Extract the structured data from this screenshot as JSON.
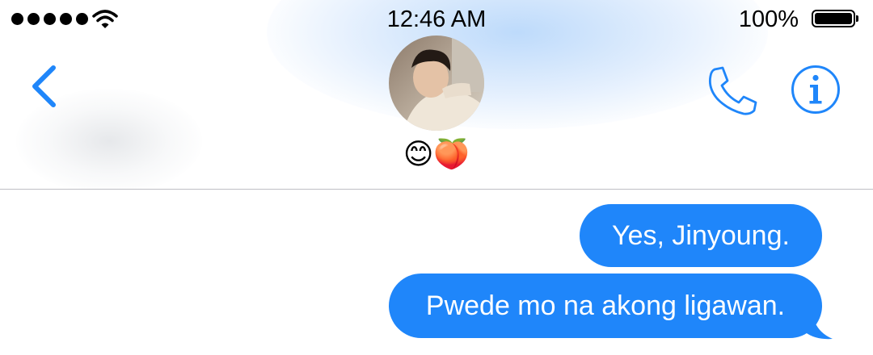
{
  "status_bar": {
    "time": "12:46 AM",
    "battery_percent": "100%",
    "signal_bars": 5,
    "wifi_icon": "wifi-icon",
    "battery_icon": "battery-full-icon"
  },
  "nav": {
    "back_icon": "chevron-left-icon",
    "contact_name": "😊🍑",
    "avatar_icon": "contact-avatar-photo",
    "call_icon": "phone-icon",
    "info_icon": "info-icon"
  },
  "messages": [
    {
      "text": "Yes, Jinyoung.",
      "sender": "me"
    },
    {
      "text": "Pwede mo na akong ligawan.",
      "sender": "me"
    }
  ],
  "colors": {
    "accent": "#1f86fa",
    "bubble_text": "#ffffff",
    "divider": "#bfbfc4"
  }
}
